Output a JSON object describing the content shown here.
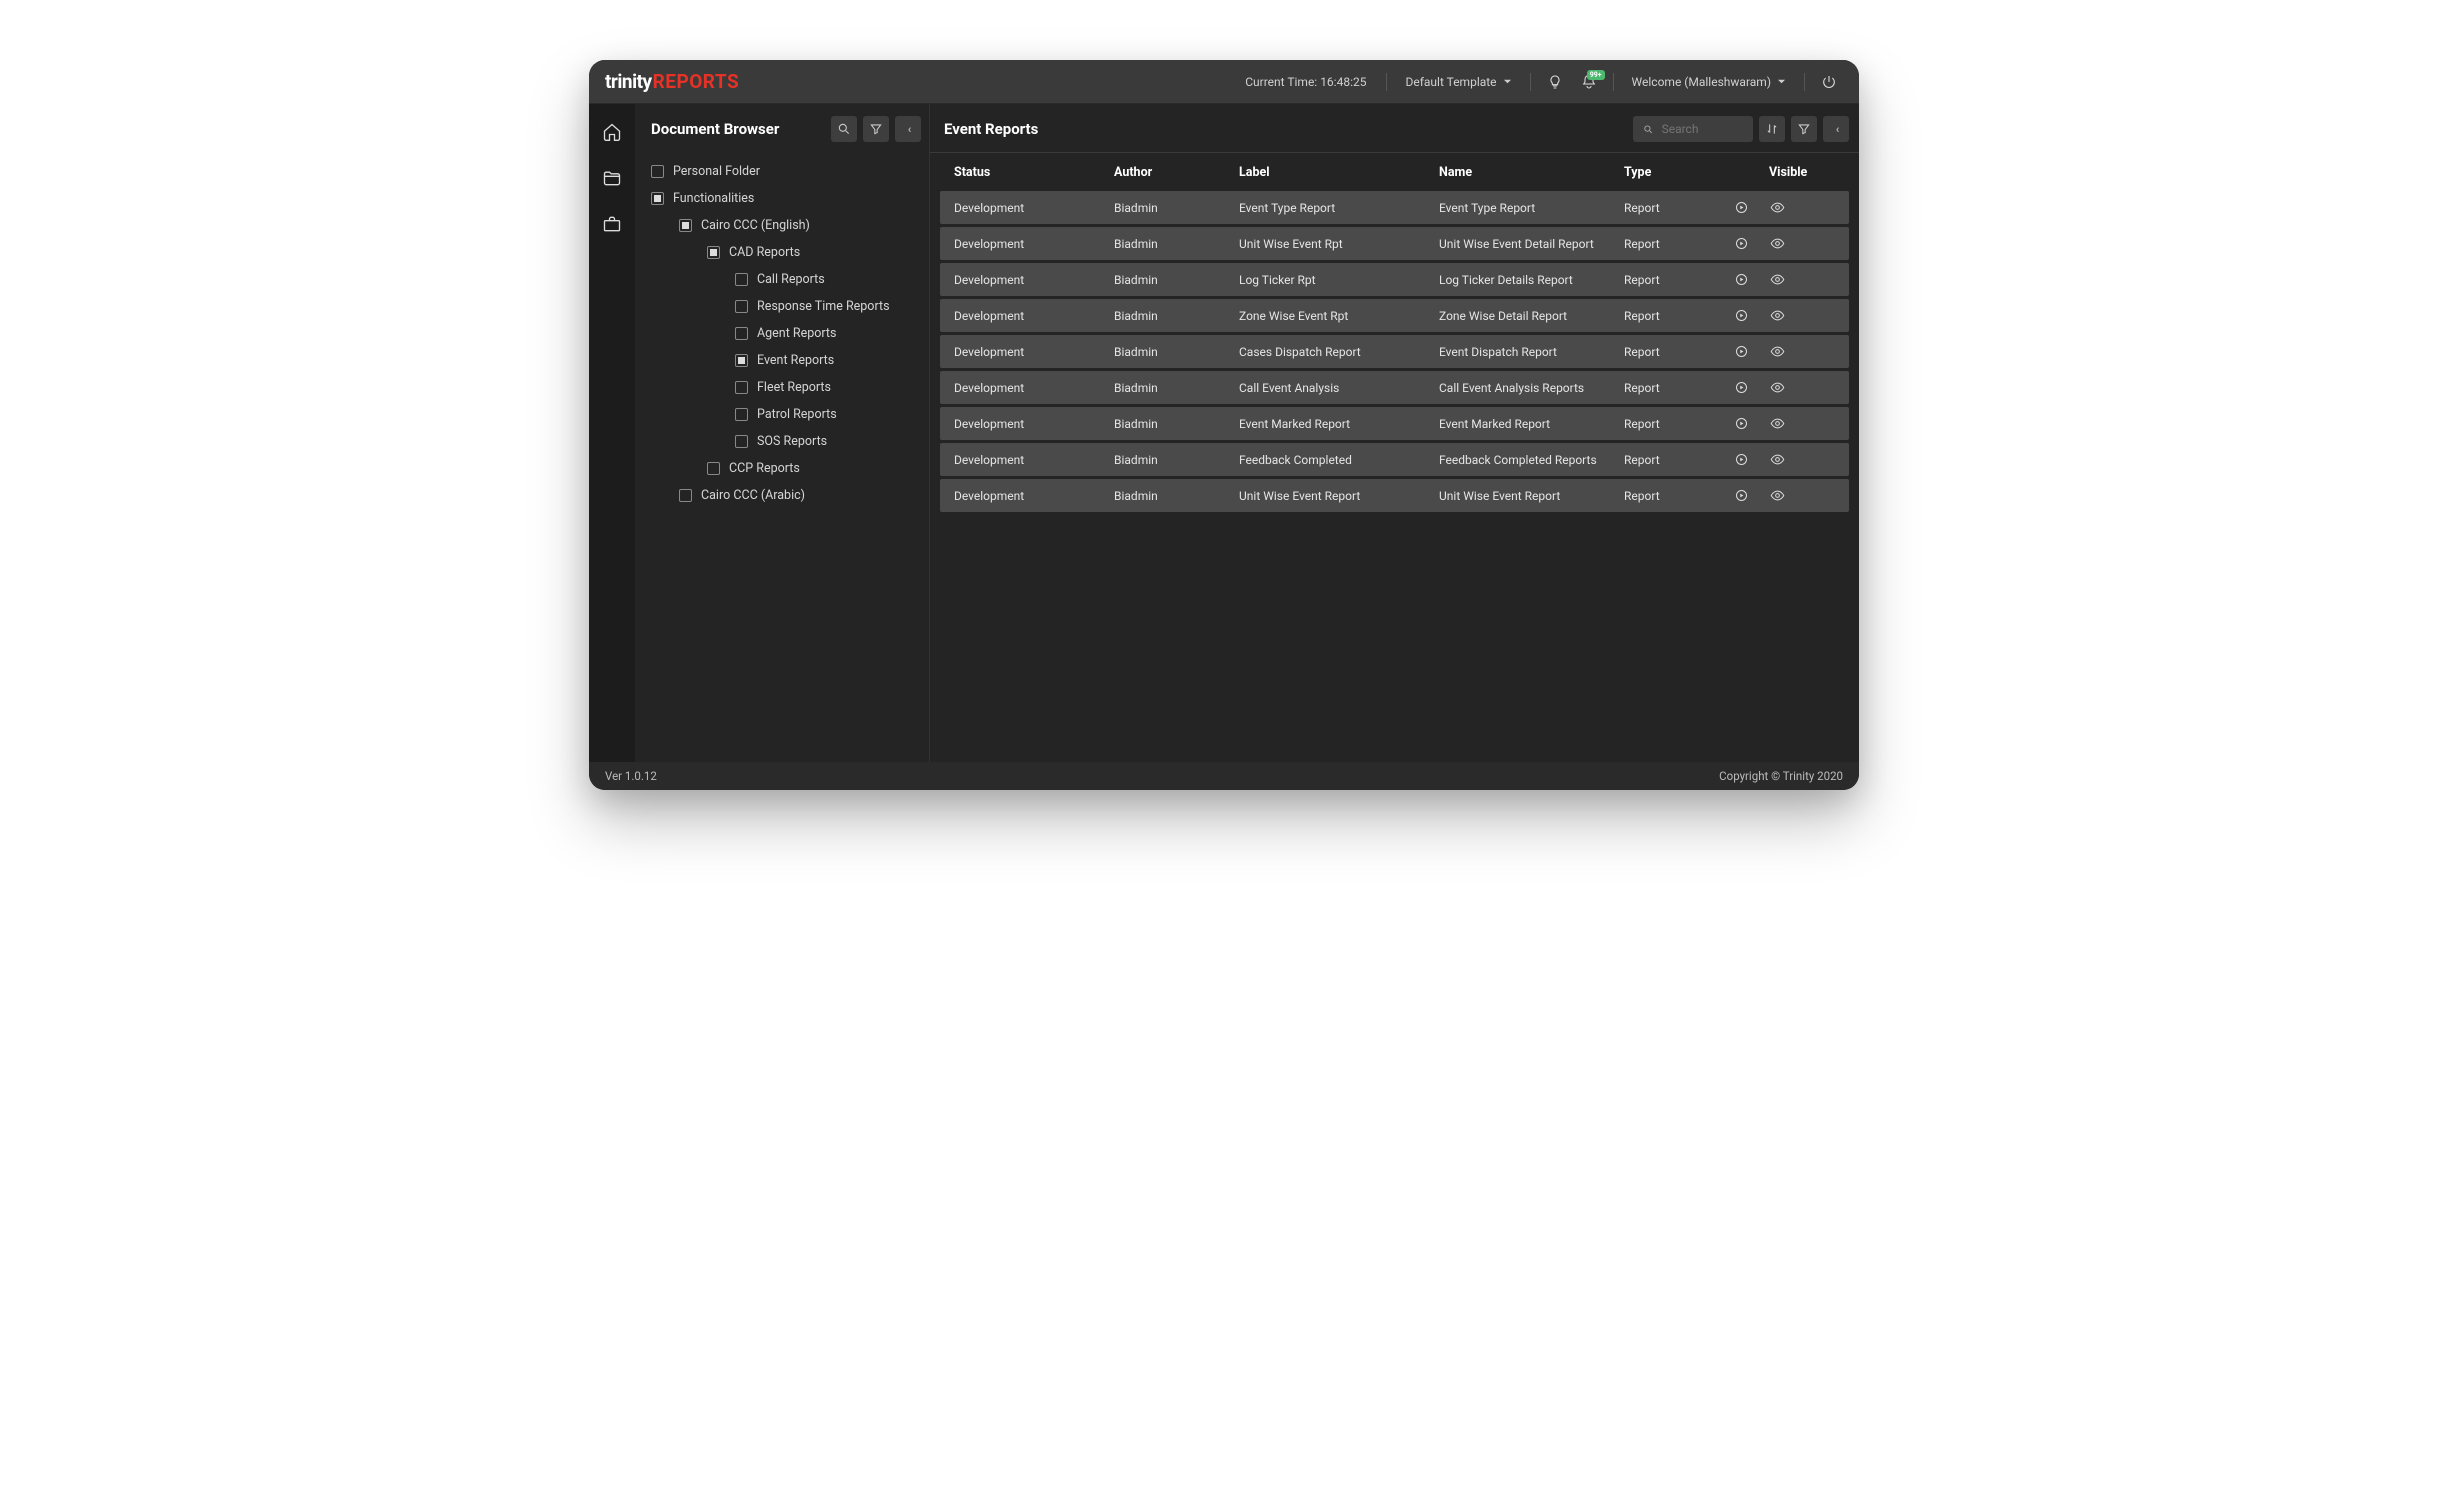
{
  "logo": {
    "a": "trinity",
    "b": "REPORTS"
  },
  "topbar": {
    "time_label": "Current Time: 16:48:25",
    "template": "Default Template",
    "welcome": "Welcome (Malleshwaram)",
    "badge": "99+"
  },
  "sidebar": {
    "title": "Document Browser",
    "collapse": "‹‹",
    "tree": [
      {
        "label": "Personal Folder",
        "indent": 16,
        "checked": false
      },
      {
        "label": "Functionalities",
        "indent": 16,
        "checked": true
      },
      {
        "label": "Cairo CCC (English)",
        "indent": 44,
        "checked": true
      },
      {
        "label": "CAD Reports",
        "indent": 72,
        "checked": true
      },
      {
        "label": "Call Reports",
        "indent": 100,
        "checked": false
      },
      {
        "label": "Response Time Reports",
        "indent": 100,
        "checked": false
      },
      {
        "label": "Agent Reports",
        "indent": 100,
        "checked": false
      },
      {
        "label": "Event Reports",
        "indent": 100,
        "checked": true
      },
      {
        "label": "Fleet Reports",
        "indent": 100,
        "checked": false
      },
      {
        "label": "Patrol Reports",
        "indent": 100,
        "checked": false
      },
      {
        "label": "SOS Reports",
        "indent": 100,
        "checked": false
      },
      {
        "label": "CCP Reports",
        "indent": 72,
        "checked": false
      },
      {
        "label": "Cairo CCC (Arabic)",
        "indent": 44,
        "checked": false
      }
    ]
  },
  "main": {
    "title": "Event Reports",
    "search_placeholder": "Search",
    "collapse": "‹‹",
    "columns": {
      "status": "Status",
      "author": "Author",
      "label": "Label",
      "name": "Name",
      "type": "Type",
      "visible": "Visible"
    },
    "rows": [
      {
        "status": "Development",
        "author": "Biadmin",
        "label": "Event Type Report",
        "name": "Event Type Report",
        "type": "Report"
      },
      {
        "status": "Development",
        "author": "Biadmin",
        "label": "Unit Wise Event Rpt",
        "name": "Unit Wise Event Detail Report",
        "type": "Report"
      },
      {
        "status": "Development",
        "author": "Biadmin",
        "label": "Log Ticker Rpt",
        "name": "Log Ticker Details Report",
        "type": "Report"
      },
      {
        "status": "Development",
        "author": "Biadmin",
        "label": "Zone Wise Event Rpt",
        "name": "Zone Wise Detail Report",
        "type": "Report"
      },
      {
        "status": "Development",
        "author": "Biadmin",
        "label": "Cases Dispatch Report",
        "name": "Event Dispatch Report",
        "type": "Report"
      },
      {
        "status": "Development",
        "author": "Biadmin",
        "label": "Call Event Analysis",
        "name": "Call Event Analysis Reports",
        "type": "Report"
      },
      {
        "status": "Development",
        "author": "Biadmin",
        "label": "Event Marked Report",
        "name": "Event Marked Report",
        "type": "Report"
      },
      {
        "status": "Development",
        "author": "Biadmin",
        "label": "Feedback Completed",
        "name": "Feedback Completed Reports",
        "type": "Report"
      },
      {
        "status": "Development",
        "author": "Biadmin",
        "label": "Unit Wise Event Report",
        "name": "Unit Wise Event Report",
        "type": "Report"
      }
    ]
  },
  "footer": {
    "version": "Ver 1.0.12",
    "copyright": "Copyright © Trinity 2020"
  }
}
